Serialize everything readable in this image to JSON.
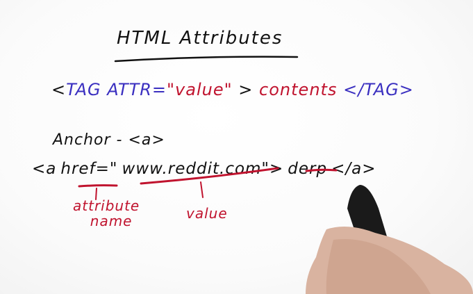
{
  "title": "HTML Attributes",
  "syntax": {
    "open": "<",
    "tag": "TAG",
    "attr": "ATTR=",
    "value": "\"value\"",
    "close": ">",
    "contents": "contents",
    "end_tag": "</TAG>"
  },
  "anchor_label": "Anchor - <a>",
  "example": {
    "open": "<a",
    "attr": "href=\"",
    "url": "www.reddit.com\">",
    "text": "derp",
    "end": "</a>"
  },
  "annotations": {
    "attribute_line1": "attribute",
    "attribute_line2": "name",
    "value": "value"
  },
  "colors": {
    "ink_black": "#111111",
    "ink_blue": "#3a2fc0",
    "ink_red": "#c0132e"
  }
}
